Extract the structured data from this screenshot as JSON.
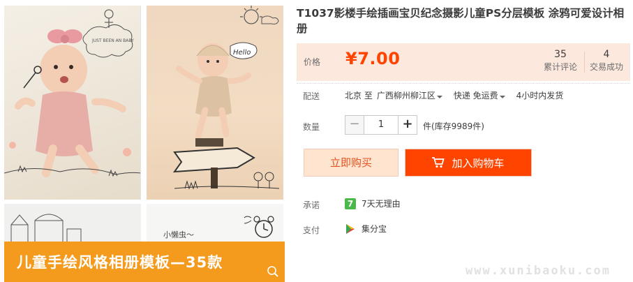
{
  "product": {
    "title": "T1037影楼手绘插画宝贝纪念摄影儿童PS分层模板 涂鸦可爱设计相册"
  },
  "gallery": {
    "banner_text": "儿童手绘风格相册模板—35款",
    "doodle_sign": "Hello",
    "doodle_text": "小懒虫～",
    "doodle_note": "JUST BEEN AN BABY"
  },
  "price": {
    "label": "价格",
    "value": "¥7.00",
    "reviews_count": "35",
    "reviews_label": "累计评论",
    "deals_count": "4",
    "deals_label": "交易成功"
  },
  "shipping": {
    "label": "配送",
    "from": "北京 至",
    "to": "广西柳州柳江区",
    "method": "快递 免运费",
    "time": "4小时内发货"
  },
  "quantity": {
    "label": "数量",
    "minus": "−",
    "value": "1",
    "plus": "+",
    "stock": "件(库存9989件)"
  },
  "actions": {
    "buy_now": "立即购买",
    "add_to_cart": "加入购物车"
  },
  "promise": {
    "label": "承诺",
    "icon_text": "7",
    "text": "7天无理由"
  },
  "payment": {
    "label": "支付",
    "text": "集分宝"
  },
  "watermark": "www.xunibaoku.com",
  "colors": {
    "accent": "#ff4400",
    "price_bg": "#fde8de",
    "banner": "#f49a1c",
    "promise_green": "#4bb94a"
  }
}
